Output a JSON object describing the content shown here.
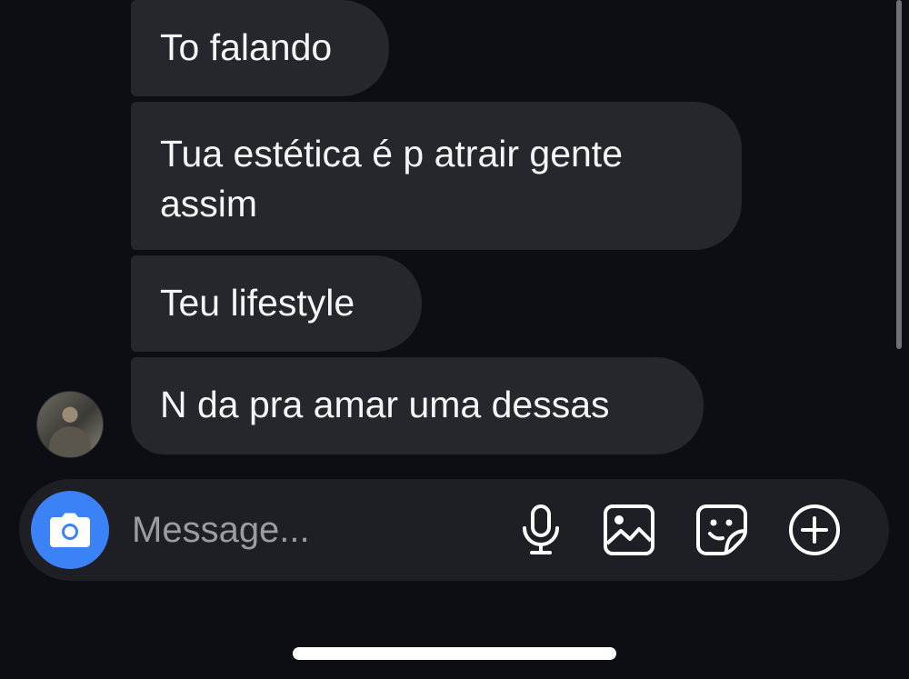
{
  "messages": [
    {
      "text": "To falando"
    },
    {
      "text": "Tua estética é p atrair gente assim"
    },
    {
      "text": "Teu lifestyle"
    },
    {
      "text": "N da pra amar uma dessas"
    }
  ],
  "composer": {
    "placeholder": "Message...",
    "accent_color": "#3a82f6",
    "icons": [
      "camera-icon",
      "microphone-icon",
      "gallery-icon",
      "sticker-icon",
      "plus-circle-icon"
    ]
  }
}
